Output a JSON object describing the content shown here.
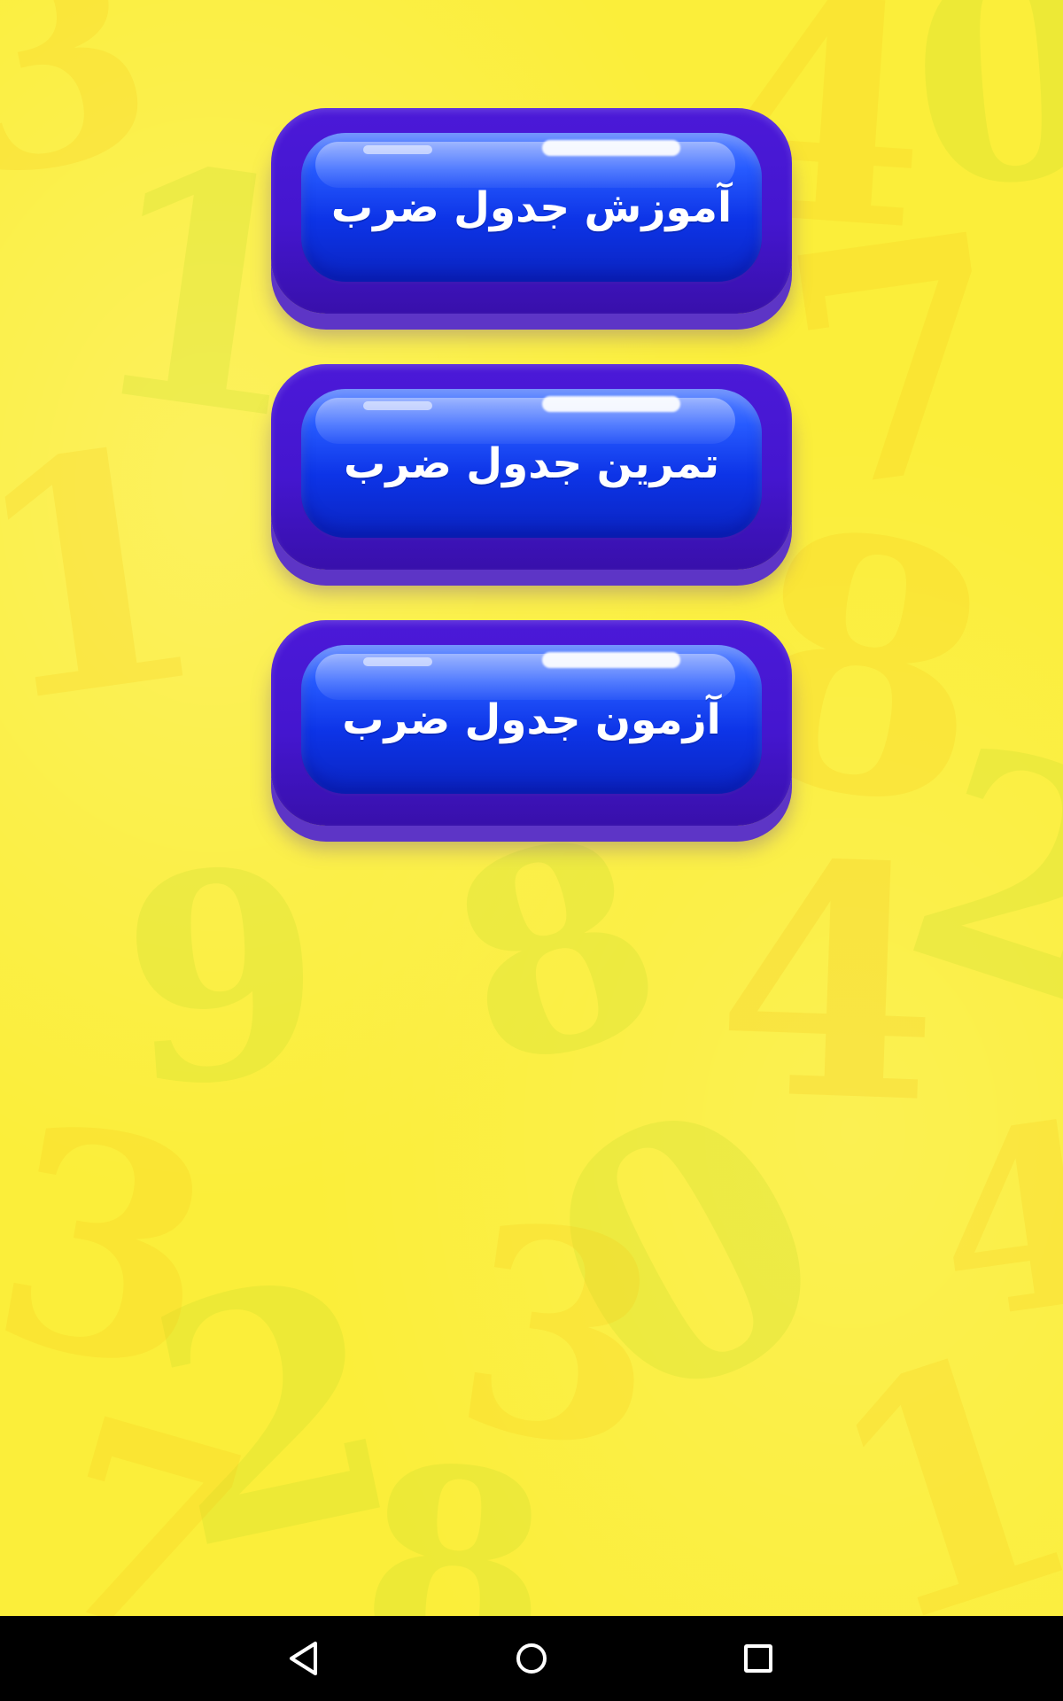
{
  "menu": {
    "buttons": [
      {
        "label": "آموزش جدول ضرب"
      },
      {
        "label": "تمرین جدول ضرب"
      },
      {
        "label": "آزمون جدول ضرب"
      }
    ]
  },
  "background": {
    "color": "#fbee3a",
    "digits": [
      "3",
      "1",
      "4",
      "0",
      "7",
      "8",
      "9",
      "1",
      "4",
      "0",
      "8",
      "2",
      "3",
      "7",
      "2",
      "3",
      "8",
      "4",
      "1"
    ]
  },
  "nav": {
    "icons": [
      "back-triangle-icon",
      "home-circle-icon",
      "recent-square-icon"
    ]
  },
  "colors": {
    "button_outer": "#4416cf",
    "button_inner": "#0d34e7",
    "button_text": "#ffffff",
    "nav_bar": "#000000"
  }
}
